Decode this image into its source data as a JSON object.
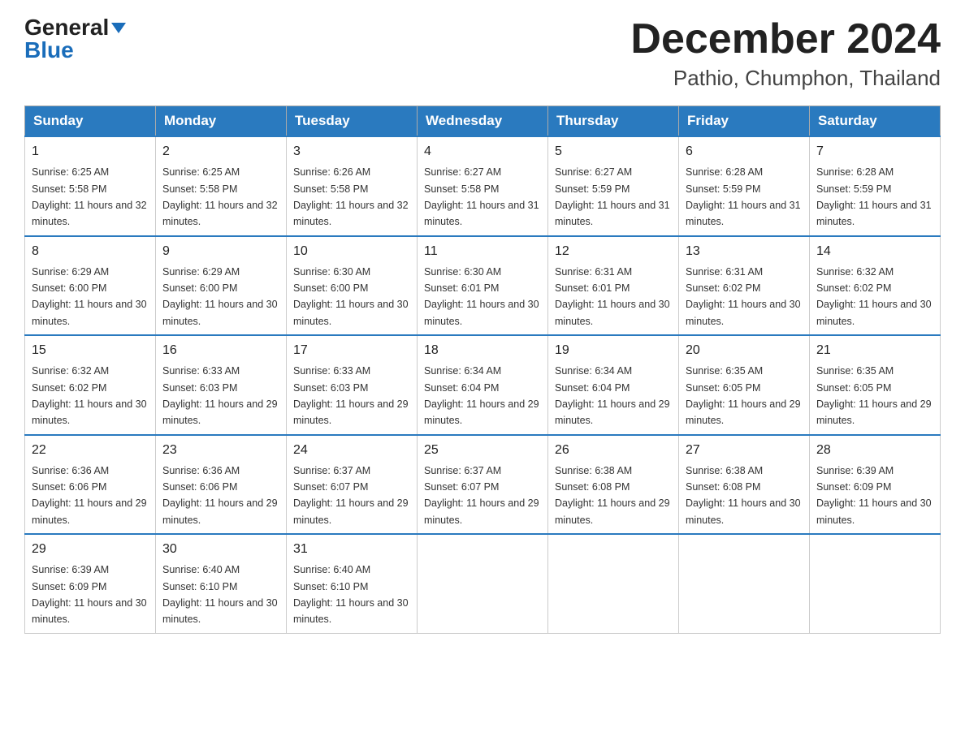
{
  "header": {
    "logo_general": "General",
    "logo_blue": "Blue",
    "month_title": "December 2024",
    "location": "Pathio, Chumphon, Thailand"
  },
  "days_of_week": [
    "Sunday",
    "Monday",
    "Tuesday",
    "Wednesday",
    "Thursday",
    "Friday",
    "Saturday"
  ],
  "weeks": [
    [
      {
        "day": "1",
        "sunrise": "6:25 AM",
        "sunset": "5:58 PM",
        "daylight": "11 hours and 32 minutes."
      },
      {
        "day": "2",
        "sunrise": "6:25 AM",
        "sunset": "5:58 PM",
        "daylight": "11 hours and 32 minutes."
      },
      {
        "day": "3",
        "sunrise": "6:26 AM",
        "sunset": "5:58 PM",
        "daylight": "11 hours and 32 minutes."
      },
      {
        "day": "4",
        "sunrise": "6:27 AM",
        "sunset": "5:58 PM",
        "daylight": "11 hours and 31 minutes."
      },
      {
        "day": "5",
        "sunrise": "6:27 AM",
        "sunset": "5:59 PM",
        "daylight": "11 hours and 31 minutes."
      },
      {
        "day": "6",
        "sunrise": "6:28 AM",
        "sunset": "5:59 PM",
        "daylight": "11 hours and 31 minutes."
      },
      {
        "day": "7",
        "sunrise": "6:28 AM",
        "sunset": "5:59 PM",
        "daylight": "11 hours and 31 minutes."
      }
    ],
    [
      {
        "day": "8",
        "sunrise": "6:29 AM",
        "sunset": "6:00 PM",
        "daylight": "11 hours and 30 minutes."
      },
      {
        "day": "9",
        "sunrise": "6:29 AM",
        "sunset": "6:00 PM",
        "daylight": "11 hours and 30 minutes."
      },
      {
        "day": "10",
        "sunrise": "6:30 AM",
        "sunset": "6:00 PM",
        "daylight": "11 hours and 30 minutes."
      },
      {
        "day": "11",
        "sunrise": "6:30 AM",
        "sunset": "6:01 PM",
        "daylight": "11 hours and 30 minutes."
      },
      {
        "day": "12",
        "sunrise": "6:31 AM",
        "sunset": "6:01 PM",
        "daylight": "11 hours and 30 minutes."
      },
      {
        "day": "13",
        "sunrise": "6:31 AM",
        "sunset": "6:02 PM",
        "daylight": "11 hours and 30 minutes."
      },
      {
        "day": "14",
        "sunrise": "6:32 AM",
        "sunset": "6:02 PM",
        "daylight": "11 hours and 30 minutes."
      }
    ],
    [
      {
        "day": "15",
        "sunrise": "6:32 AM",
        "sunset": "6:02 PM",
        "daylight": "11 hours and 30 minutes."
      },
      {
        "day": "16",
        "sunrise": "6:33 AM",
        "sunset": "6:03 PM",
        "daylight": "11 hours and 29 minutes."
      },
      {
        "day": "17",
        "sunrise": "6:33 AM",
        "sunset": "6:03 PM",
        "daylight": "11 hours and 29 minutes."
      },
      {
        "day": "18",
        "sunrise": "6:34 AM",
        "sunset": "6:04 PM",
        "daylight": "11 hours and 29 minutes."
      },
      {
        "day": "19",
        "sunrise": "6:34 AM",
        "sunset": "6:04 PM",
        "daylight": "11 hours and 29 minutes."
      },
      {
        "day": "20",
        "sunrise": "6:35 AM",
        "sunset": "6:05 PM",
        "daylight": "11 hours and 29 minutes."
      },
      {
        "day": "21",
        "sunrise": "6:35 AM",
        "sunset": "6:05 PM",
        "daylight": "11 hours and 29 minutes."
      }
    ],
    [
      {
        "day": "22",
        "sunrise": "6:36 AM",
        "sunset": "6:06 PM",
        "daylight": "11 hours and 29 minutes."
      },
      {
        "day": "23",
        "sunrise": "6:36 AM",
        "sunset": "6:06 PM",
        "daylight": "11 hours and 29 minutes."
      },
      {
        "day": "24",
        "sunrise": "6:37 AM",
        "sunset": "6:07 PM",
        "daylight": "11 hours and 29 minutes."
      },
      {
        "day": "25",
        "sunrise": "6:37 AM",
        "sunset": "6:07 PM",
        "daylight": "11 hours and 29 minutes."
      },
      {
        "day": "26",
        "sunrise": "6:38 AM",
        "sunset": "6:08 PM",
        "daylight": "11 hours and 29 minutes."
      },
      {
        "day": "27",
        "sunrise": "6:38 AM",
        "sunset": "6:08 PM",
        "daylight": "11 hours and 30 minutes."
      },
      {
        "day": "28",
        "sunrise": "6:39 AM",
        "sunset": "6:09 PM",
        "daylight": "11 hours and 30 minutes."
      }
    ],
    [
      {
        "day": "29",
        "sunrise": "6:39 AM",
        "sunset": "6:09 PM",
        "daylight": "11 hours and 30 minutes."
      },
      {
        "day": "30",
        "sunrise": "6:40 AM",
        "sunset": "6:10 PM",
        "daylight": "11 hours and 30 minutes."
      },
      {
        "day": "31",
        "sunrise": "6:40 AM",
        "sunset": "6:10 PM",
        "daylight": "11 hours and 30 minutes."
      },
      null,
      null,
      null,
      null
    ]
  ]
}
